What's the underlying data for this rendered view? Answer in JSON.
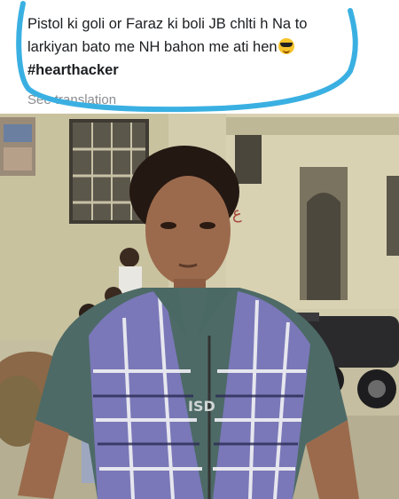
{
  "post": {
    "text_line1": "Pistol ki goli or Faraz ki boli JB chlti h Na to",
    "text_line2": "larkiyan bato me NH bahon me ati hen",
    "emoji_icon": "sunglasses-face-icon",
    "hashtag": "#hearthacker",
    "see_translation": "See translation"
  },
  "photo": {
    "shirt_print": "ISD"
  },
  "colors": {
    "scribble": "#3ab0e2",
    "text": "#1c1e21",
    "muted": "#8a8d91"
  }
}
